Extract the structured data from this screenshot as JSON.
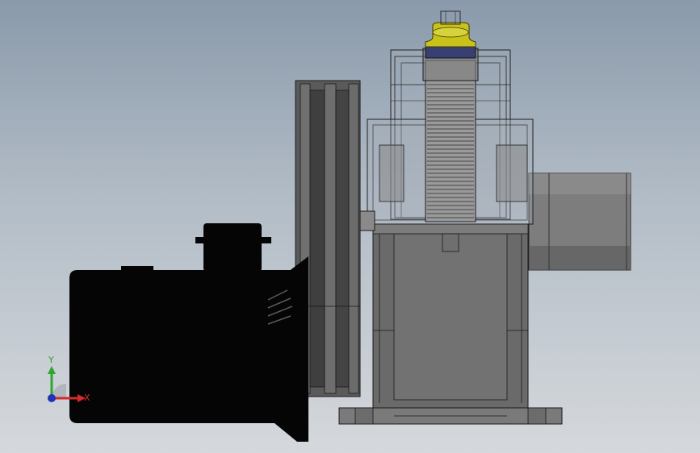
{
  "triad": {
    "x_label": "X",
    "y_label": "Y",
    "x_color": "#d42a2a",
    "y_color": "#2fa52f",
    "z_color": "#2232b8"
  },
  "colors": {
    "motor": "#050505",
    "housing": "#6a6a6a",
    "housing_dark": "#545454",
    "pulley": "#4a4a4a",
    "shaft": "#858585",
    "flange_cap": "#c9c21b",
    "bearing_ring": "#3a3f72"
  },
  "icons": {
    "triad": "coordinate-triad-icon"
  }
}
